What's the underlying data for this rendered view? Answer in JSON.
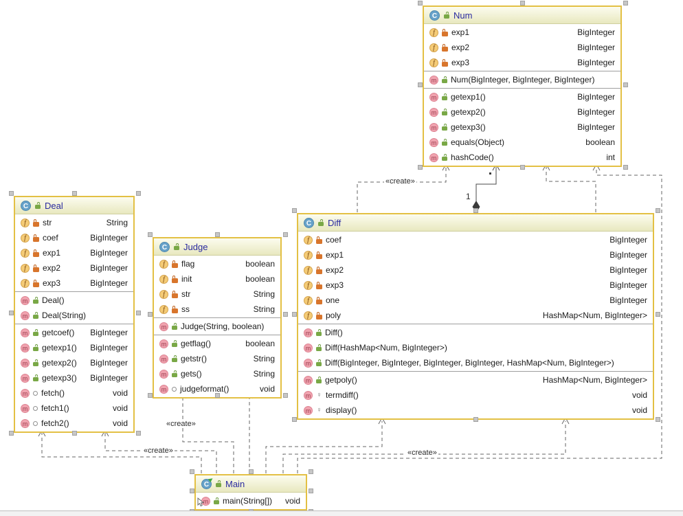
{
  "labels": {
    "create": "«create»",
    "one": "1",
    "star": "*"
  },
  "classes": [
    {
      "name": "Num",
      "fields": [
        {
          "name": "exp1",
          "type": "BigInteger",
          "visibility": "private"
        },
        {
          "name": "exp2",
          "type": "BigInteger",
          "visibility": "private"
        },
        {
          "name": "exp3",
          "type": "BigInteger",
          "visibility": "private"
        }
      ],
      "constructors": [
        {
          "name": "Num(BigInteger, BigInteger, BigInteger)",
          "type": "",
          "visibility": "public"
        }
      ],
      "methods": [
        {
          "name": "getexp1()",
          "type": "BigInteger",
          "visibility": "public"
        },
        {
          "name": "getexp2()",
          "type": "BigInteger",
          "visibility": "public"
        },
        {
          "name": "getexp3()",
          "type": "BigInteger",
          "visibility": "public"
        },
        {
          "name": "equals(Object)",
          "type": "boolean",
          "visibility": "public"
        },
        {
          "name": "hashCode()",
          "type": "int",
          "visibility": "public"
        }
      ]
    },
    {
      "name": "Deal",
      "fields": [
        {
          "name": "str",
          "type": "String",
          "visibility": "private"
        },
        {
          "name": "coef",
          "type": "BigInteger",
          "visibility": "private"
        },
        {
          "name": "exp1",
          "type": "BigInteger",
          "visibility": "private"
        },
        {
          "name": "exp2",
          "type": "BigInteger",
          "visibility": "private"
        },
        {
          "name": "exp3",
          "type": "BigInteger",
          "visibility": "private"
        }
      ],
      "constructors": [
        {
          "name": "Deal()",
          "type": "",
          "visibility": "public"
        },
        {
          "name": "Deal(String)",
          "type": "",
          "visibility": "public"
        }
      ],
      "methods": [
        {
          "name": "getcoef()",
          "type": "BigInteger",
          "visibility": "public"
        },
        {
          "name": "getexp1()",
          "type": "BigInteger",
          "visibility": "public"
        },
        {
          "name": "getexp2()",
          "type": "BigInteger",
          "visibility": "public"
        },
        {
          "name": "getexp3()",
          "type": "BigInteger",
          "visibility": "public"
        },
        {
          "name": "fetch()",
          "type": "void",
          "visibility": "package"
        },
        {
          "name": "fetch1()",
          "type": "void",
          "visibility": "package"
        },
        {
          "name": "fetch2()",
          "type": "void",
          "visibility": "package"
        }
      ]
    },
    {
      "name": "Judge",
      "fields": [
        {
          "name": "flag",
          "type": "boolean",
          "visibility": "private"
        },
        {
          "name": "init",
          "type": "boolean",
          "visibility": "private"
        },
        {
          "name": "str",
          "type": "String",
          "visibility": "private"
        },
        {
          "name": "ss",
          "type": "String",
          "visibility": "private"
        }
      ],
      "constructors": [
        {
          "name": "Judge(String, boolean)",
          "type": "",
          "visibility": "public"
        }
      ],
      "methods": [
        {
          "name": "getflag()",
          "type": "boolean",
          "visibility": "public"
        },
        {
          "name": "getstr()",
          "type": "String",
          "visibility": "public"
        },
        {
          "name": "gets()",
          "type": "String",
          "visibility": "public"
        },
        {
          "name": "judgeformat()",
          "type": "void",
          "visibility": "package"
        }
      ]
    },
    {
      "name": "Diff",
      "fields": [
        {
          "name": "coef",
          "type": "BigInteger",
          "visibility": "private"
        },
        {
          "name": "exp1",
          "type": "BigInteger",
          "visibility": "private"
        },
        {
          "name": "exp2",
          "type": "BigInteger",
          "visibility": "private"
        },
        {
          "name": "exp3",
          "type": "BigInteger",
          "visibility": "private"
        },
        {
          "name": "one",
          "type": "BigInteger",
          "visibility": "private"
        },
        {
          "name": "poly",
          "type": "HashMap<Num, BigInteger>",
          "visibility": "private"
        }
      ],
      "constructors": [
        {
          "name": "Diff()",
          "type": "",
          "visibility": "public"
        },
        {
          "name": "Diff(HashMap<Num, BigInteger>)",
          "type": "",
          "visibility": "public"
        },
        {
          "name": "Diff(BigInteger, BigInteger, BigInteger, BigInteger, HashMap<Num, BigInteger>)",
          "type": "",
          "visibility": "public"
        }
      ],
      "methods": [
        {
          "name": "getpoly()",
          "type": "HashMap<Num, BigInteger>",
          "visibility": "public"
        },
        {
          "name": "termdiff()",
          "type": "void",
          "visibility": "package-key"
        },
        {
          "name": "display()",
          "type": "void",
          "visibility": "package-key"
        }
      ]
    },
    {
      "name": "Main",
      "fields": [],
      "constructors": [],
      "methods": [
        {
          "name": "main(String[])",
          "type": "void",
          "visibility": "public"
        }
      ]
    }
  ],
  "edges": [
    {
      "from": "Diff",
      "to": "Num",
      "kind": "create-dependency",
      "label": "«create»"
    },
    {
      "from": "Diff",
      "to": "Num",
      "kind": "composition",
      "source_multiplicity": "1",
      "target_multiplicity": "*"
    },
    {
      "from": "Diff",
      "to": "Num",
      "kind": "dependency",
      "label": ""
    },
    {
      "from": "Main",
      "to": "Num",
      "kind": "create-dependency",
      "label": ""
    },
    {
      "from": "Main",
      "to": "Diff",
      "kind": "create-dependency",
      "label": "«create»"
    },
    {
      "from": "Main",
      "to": "Diff",
      "kind": "create-dependency",
      "label": ""
    },
    {
      "from": "Main",
      "to": "Judge",
      "kind": "create-dependency",
      "label": "«create»"
    },
    {
      "from": "Main",
      "to": "Judge",
      "kind": "create-dependency",
      "label": ""
    },
    {
      "from": "Main",
      "to": "Deal",
      "kind": "create-dependency",
      "label": "«create»"
    },
    {
      "from": "Main",
      "to": "Deal",
      "kind": "create-dependency",
      "label": ""
    }
  ]
}
